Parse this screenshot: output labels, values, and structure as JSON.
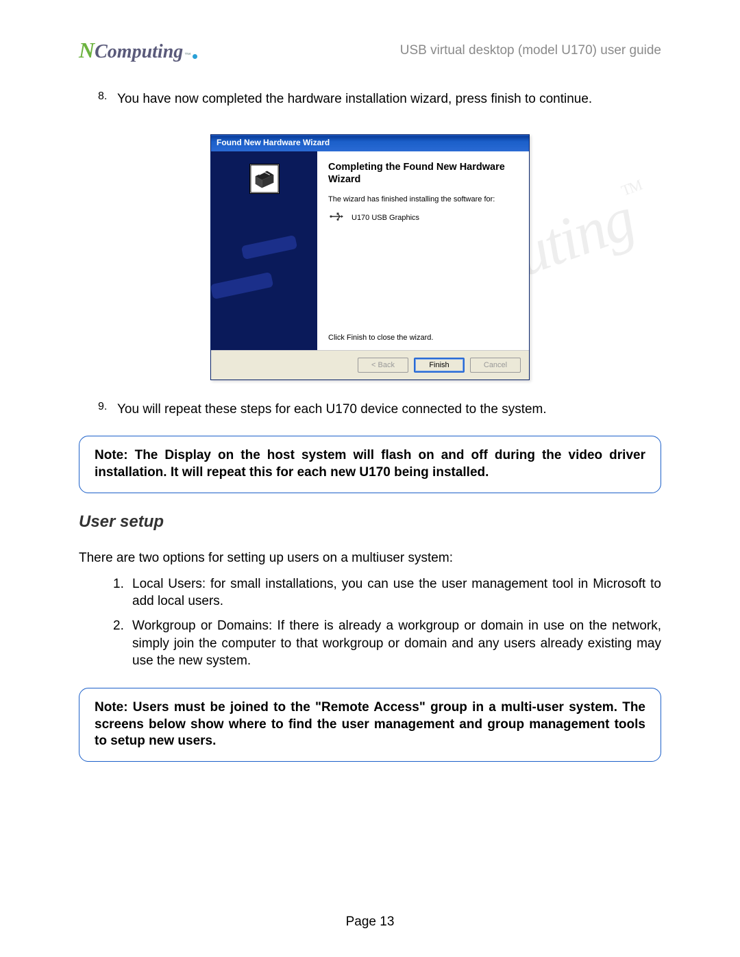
{
  "header": {
    "logo_n": "N",
    "logo_rest": "Computing",
    "logo_tm": "™",
    "doc_title": "USB virtual desktop (model U170) user guide"
  },
  "step8": {
    "num": "8.",
    "text": "You have now completed the hardware installation wizard, press finish to continue."
  },
  "wizard": {
    "titlebar": "Found New Hardware Wizard",
    "heading": "Completing the Found New Hardware Wizard",
    "subtext": "The wizard has finished installing the software for:",
    "device": "U170 USB Graphics",
    "close_text": "Click Finish to close the wizard.",
    "btn_back": "< Back",
    "btn_finish": "Finish",
    "btn_cancel": "Cancel"
  },
  "step9": {
    "num": "9.",
    "text": "You will repeat these steps for each U170 device connected to the system."
  },
  "note1": "Note: The Display on the host system will flash on and off during the video driver installation. It will repeat this for each new U170 being installed.",
  "section_heading": "User setup",
  "para_intro": "There are two options for setting up users on a multiuser system:",
  "opt1": {
    "num": "1.",
    "text": "Local Users: for small installations, you can use the user management tool in Microsoft to add local users."
  },
  "opt2": {
    "num": "2.",
    "text": "Workgroup or Domains: If there is already a workgroup or domain in use on the network, simply join the computer to that workgroup or domain and any users already existing may use the new system."
  },
  "note2": "Note: Users must be joined to the \"Remote Access\" group in a multi-user system. The screens below show where to find the user management and group management tools to setup new users.",
  "page_footer": "Page 13",
  "watermark_text": "NComputing",
  "watermark_tm": "TM"
}
